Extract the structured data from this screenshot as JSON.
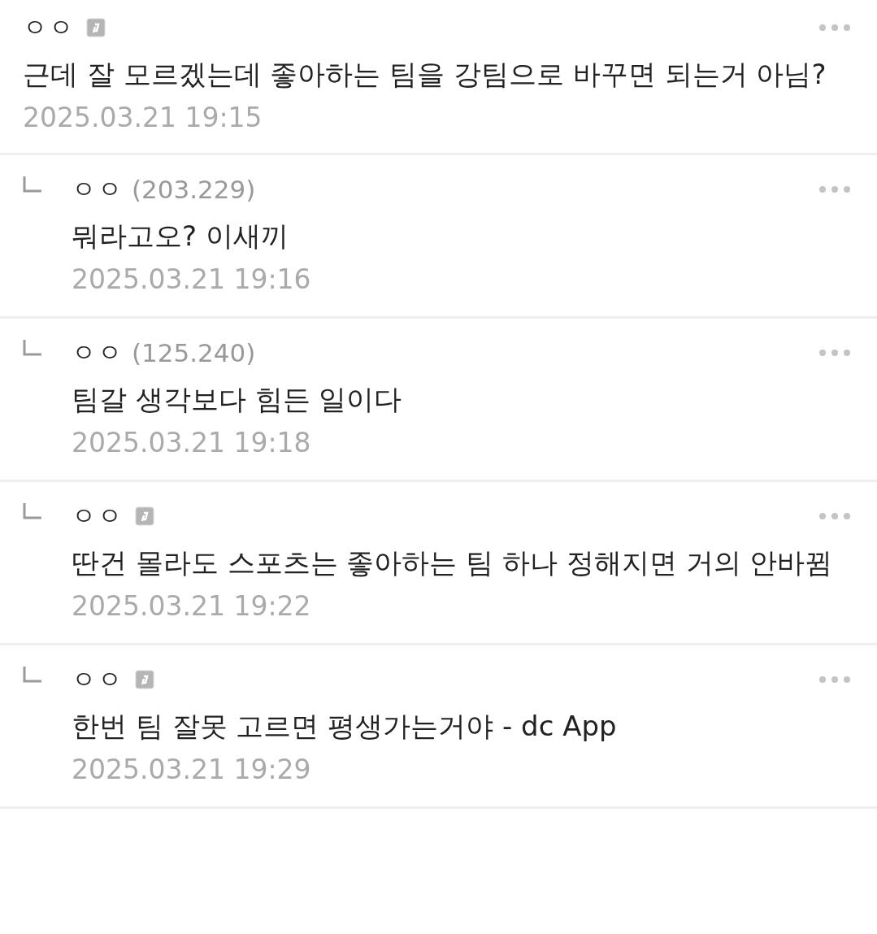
{
  "comments": [
    {
      "reply": false,
      "author": "ㅇㅇ",
      "member_badge": true,
      "text": "근데 잘 모르겠는데 좋아하는 팀을 강팀으로 바꾸면 되는거 아님?",
      "date": "2025.03.21 19:15"
    },
    {
      "reply": true,
      "author": "ㅇㅇ",
      "ip": "(203.229)",
      "member_badge": false,
      "text": "뭐라고오? 이새끼",
      "date": "2025.03.21 19:16"
    },
    {
      "reply": true,
      "author": "ㅇㅇ",
      "ip": "(125.240)",
      "member_badge": false,
      "text": "팀갈 생각보다 힘든 일이다",
      "date": "2025.03.21 19:18"
    },
    {
      "reply": true,
      "author": "ㅇㅇ",
      "member_badge": true,
      "text": "딴건 몰라도 스포츠는 좋아하는 팀 하나 정해지면 거의 안바뀜",
      "date": "2025.03.21 19:22"
    },
    {
      "reply": true,
      "author": "ㅇㅇ",
      "member_badge": true,
      "text": "한번 팀 잘못 고르면 평생가는거야 - dc App",
      "date": "2025.03.21 19:29"
    }
  ]
}
